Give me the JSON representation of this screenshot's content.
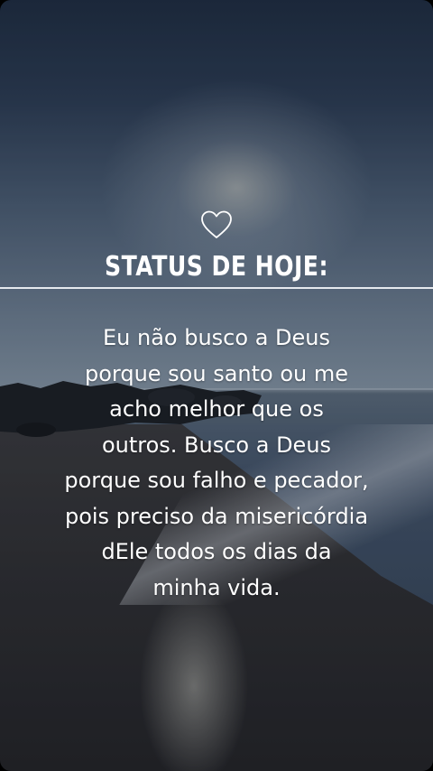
{
  "card": {
    "icon": "heart-outline-icon",
    "title": "STATUS DE HOJE:",
    "message_lines": [
      "Eu não busco a Deus",
      "porque sou santo ou me",
      "acho melhor que os",
      "outros. Busco a Deus",
      "porque sou falho e pecador,",
      "pois preciso da misericórdia",
      "dEle todos os dias da",
      "minha vida."
    ]
  },
  "colors": {
    "text": "#ffffff",
    "divider": "#e6e9ee",
    "sky_top": "#1f2d41",
    "sea": "#44546a",
    "sand": "#2e2e31"
  }
}
